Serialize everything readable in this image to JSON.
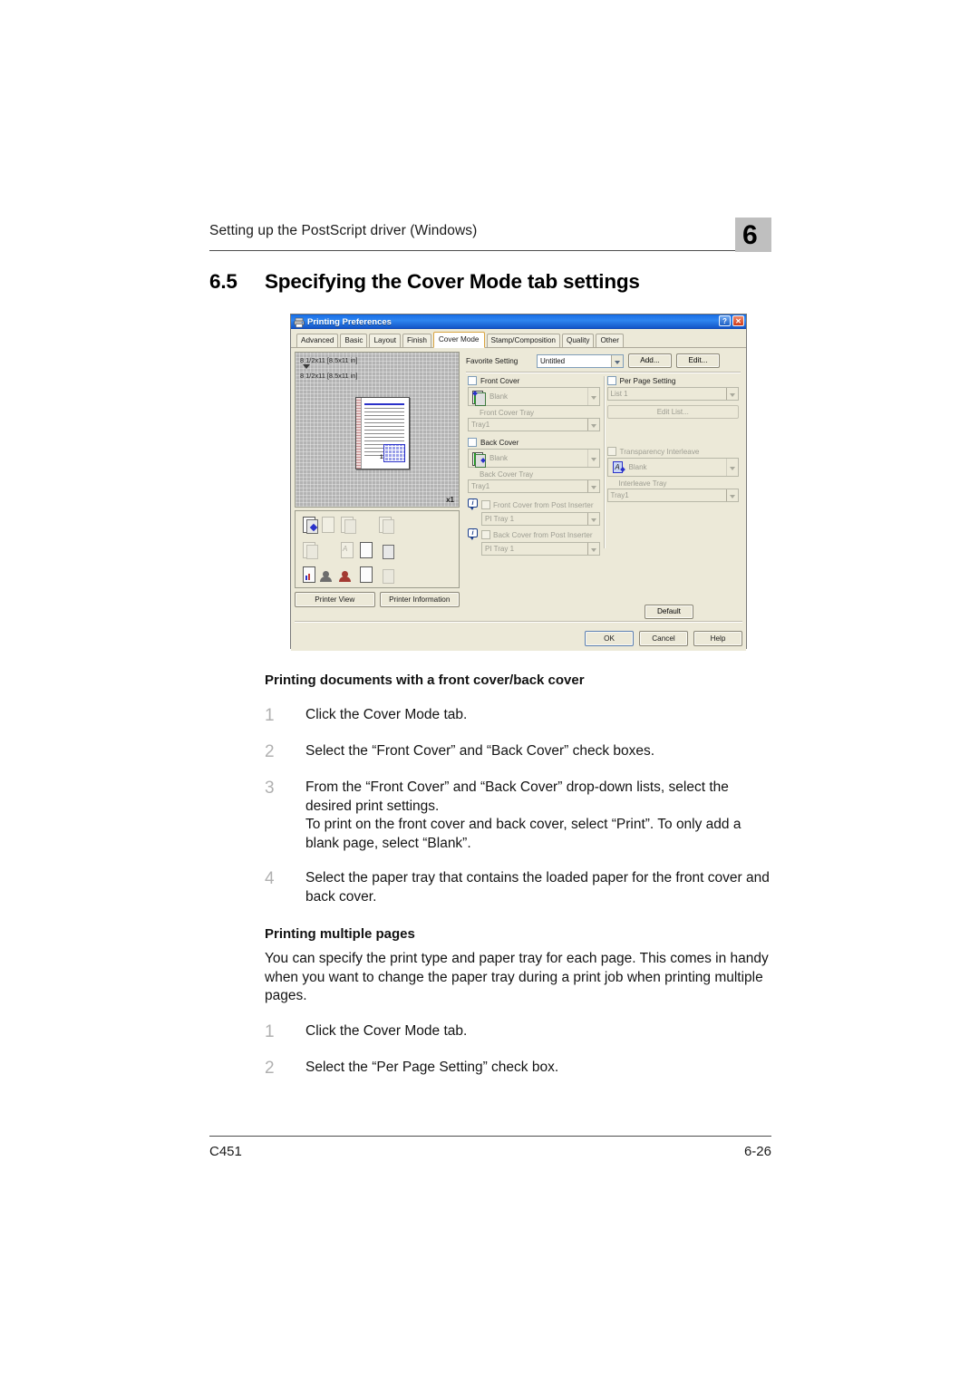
{
  "page": {
    "running_head": "Setting up the PostScript driver (Windows)",
    "chapter_number": "6",
    "section_number": "6.5",
    "section_title": "Specifying the Cover Mode tab settings",
    "footer_left": "C451",
    "footer_right": "6-26"
  },
  "dialog": {
    "title": "Printing Preferences",
    "titlebar_buttons": {
      "help": "?",
      "close": "✕"
    },
    "tabs": [
      {
        "label": "Advanced",
        "active": false
      },
      {
        "label": "Basic",
        "active": false
      },
      {
        "label": "Layout",
        "active": false
      },
      {
        "label": "Finish",
        "active": false
      },
      {
        "label": "Cover Mode",
        "active": true
      },
      {
        "label": "Stamp/Composition",
        "active": false
      },
      {
        "label": "Quality",
        "active": false
      },
      {
        "label": "Other",
        "active": false
      }
    ],
    "preview": {
      "size_top": "8 1/2x11 [8.5x11 in]",
      "size_bottom": "8 1/2x11 [8.5x11 in]",
      "copies": "x1",
      "page_label": "1"
    },
    "preview_buttons": {
      "printer_view": "Printer View",
      "printer_information": "Printer Information"
    },
    "favorite": {
      "label": "Favorite Setting",
      "value": "Untitled",
      "add_button": "Add...",
      "edit_button": "Edit..."
    },
    "left_column": {
      "front_cover": {
        "label": "Front Cover",
        "checked": false,
        "value": "Blank"
      },
      "front_cover_tray": {
        "label": "Front Cover Tray",
        "value": "Tray1"
      },
      "back_cover": {
        "label": "Back Cover",
        "checked": false,
        "value": "Blank"
      },
      "back_cover_tray": {
        "label": "Back Cover Tray",
        "value": "Tray1"
      },
      "front_cover_post_inserter": {
        "label": "Front Cover from Post Inserter",
        "checked": false,
        "value": "PI Tray 1"
      },
      "back_cover_post_inserter": {
        "label": "Back Cover from Post Inserter",
        "checked": false,
        "value": "PI Tray 1"
      }
    },
    "right_column": {
      "per_page_setting": {
        "label": "Per Page Setting",
        "checked": false,
        "value": "List 1"
      },
      "edit_list_button": "Edit List...",
      "transparency_interleave": {
        "label": "Transparency Interleave",
        "checked": false,
        "value": "Blank"
      },
      "interleave_tray": {
        "label": "Interleave Tray",
        "value": "Tray1"
      }
    },
    "buttons": {
      "default": "Default",
      "ok": "OK",
      "cancel": "Cancel",
      "help": "Help"
    }
  },
  "content": {
    "section1_heading": "Printing documents with a front cover/back cover",
    "section1_steps": [
      {
        "num": "1",
        "text": "Click the Cover Mode tab."
      },
      {
        "num": "2",
        "text": "Select the “Front Cover” and “Back Cover” check boxes."
      },
      {
        "num": "3",
        "text": "From the “Front Cover” and “Back Cover” drop-down lists, select the desired print settings.\nTo print on the front cover and back cover, select “Print”. To only add a blank page, select “Blank”."
      },
      {
        "num": "4",
        "text": "Select the paper tray that contains the loaded paper for the front cover and back cover."
      }
    ],
    "section2_heading": "Printing multiple pages",
    "section2_paragraph": "You can specify the print type and paper tray for each page. This comes in handy when you want to change the paper tray during a print job when printing multiple pages.",
    "section2_steps": [
      {
        "num": "1",
        "text": "Click the Cover Mode tab."
      },
      {
        "num": "2",
        "text": "Select the “Per Page Setting” check box."
      }
    ]
  }
}
